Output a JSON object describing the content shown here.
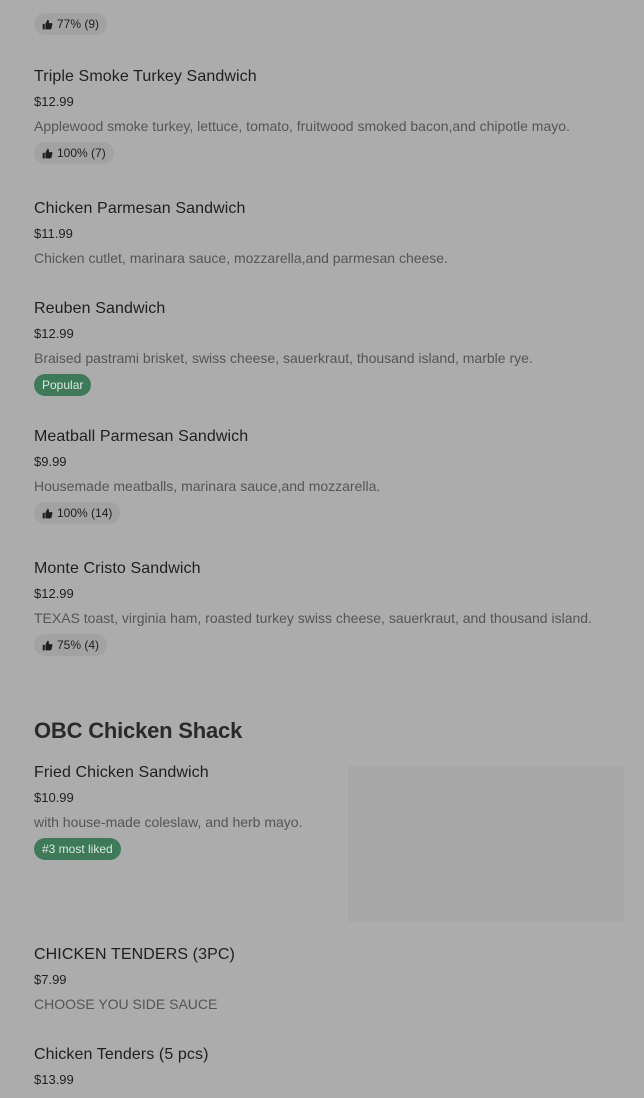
{
  "top_item": {
    "rating": "77% (9)"
  },
  "items": [
    {
      "name": "Triple Smoke Turkey Sandwich",
      "price": "$12.99",
      "description": "Applewood smoke turkey, lettuce, tomato, fruitwood smoked bacon,and chipotle mayo.",
      "rating": "100% (7)"
    },
    {
      "name": "Chicken Parmesan Sandwich",
      "price": "$11.99",
      "description": "Chicken cutlet, marinara sauce, mozzarella,and parmesan cheese."
    },
    {
      "name": "Reuben Sandwich",
      "price": "$12.99",
      "description": "Braised pastrami brisket, swiss cheese, sauerkraut, thousand island, marble rye.",
      "badge": "Popular"
    },
    {
      "name": "Meatball Parmesan Sandwich",
      "price": "$9.99",
      "description": "Housemade meatballs, marinara sauce,and mozzarella.",
      "rating": "100% (14)"
    },
    {
      "name": "Monte Cristo Sandwich",
      "price": "$12.99",
      "description": "TEXAS toast, virginia ham, roasted turkey swiss cheese, sauerkraut, and thousand island.",
      "rating": "75% (4)"
    }
  ],
  "section": {
    "title": "OBC Chicken Shack",
    "items": [
      {
        "name": "Fried Chicken Sandwich",
        "price": "$10.99",
        "description": "with house-made coleslaw, and herb mayo.",
        "badge": "#3 most liked"
      },
      {
        "name": "CHICKEN TENDERS (3PC)",
        "price": "$7.99",
        "description": "CHOOSE YOU SIDE SAUCE"
      },
      {
        "name": "Chicken Tenders (5 pcs)",
        "price": "$13.99"
      }
    ]
  },
  "colors": {
    "background": "#acacac",
    "badge": "#3e7a5a",
    "pill": "#a2a2a2"
  },
  "icons": {
    "rating": "thumbs-up-icon"
  }
}
